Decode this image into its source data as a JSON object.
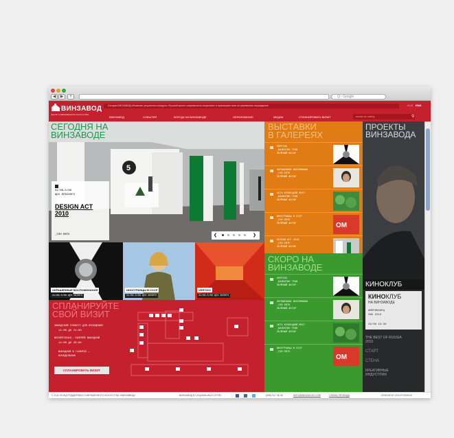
{
  "browser": {
    "search_placeholder": "Q~ Google"
  },
  "header": {
    "logo": "ВИНЗАВОД",
    "logo_sub": "ЦЕНТР СОВРЕМЕННОГО ИСКУССТВА",
    "news_ticker": "Сегодня ВИНЗАВОД объявляет результаты конкурса «Лучший проект современного искусства» и приглашает всех на церемонию награждения",
    "lang_ru": "RUS",
    "lang_en": "ENG",
    "menu": [
      "ВИНЗАВОД",
      "СОБЫТИЯ",
      "ВСЕГДА НА ВИНЗАВОДЕ",
      "ОБРАЗОВАНИЕ",
      "МЕДИА",
      "СПЛАНИРОВАТЬ ВИЗИТ"
    ],
    "search_placeholder": "поиск по сайту"
  },
  "hero": {
    "title_line1": "СЕГОДНЯ НА",
    "title_line2": "ВИНЗАВОДЕ",
    "card_date": "31/08–5/09",
    "card_venue": "ЦЕХ КРАСНОГО",
    "card_title": "DESIGN ACT 2010",
    "card_link": "_УЗН ЕВТЕ"
  },
  "thumbs": [
    {
      "caption": "ОКРАШЕННЫЕ ВОСПОМИНАНИЯ",
      "date": "31/08–5/09  ЦЕХ БЕЛОГО"
    },
    {
      "caption": "ИНОСТРАНЦЫ В СССР",
      "date": "31/08–5/09  ЦЕХ БЕЛОГО"
    },
    {
      "caption": "VERTIGO",
      "date": "31/08–5/09  ЦЕХ БЕЛОГО"
    }
  ],
  "plan": {
    "title_line1": "СПЛАНИРУЙТЕ",
    "title_line2": "СВОЙ ВИЗИТ",
    "hours1_label": "ЗАВОДСКОЙ СУББОТУ ДЛЯ ПОСЕЩЕНИЯ",
    "hours1": "11:00 ДО 21:00",
    "hours2_label": "ВОСКРЕСЕНЬЕ, ГАЛЕРЕЙ ВЫХОДНОЙ",
    "hours2": "12:00 ДО 20:00",
    "closed": "ВЫХОДНОЙ В ГАЛЕРЕЕ — ПОНЕДЕЛЬНИК",
    "button": "СПЛАНИРОВАТЬ ВИЗИТ"
  },
  "galleries": {
    "title_line1": "ВЫСТАВКИ",
    "title_line2": "В ГАЛЕРЕЯХ",
    "items": [
      {
        "text": "VERTIGO\n_ВАЛЕНТИН ТРАВ\nЗЕЛЁНЫЙ АНГАР"
      },
      {
        "text": "ОКРАШЕННЫЕ ВОСПОМИНАН\n_УЗН ЕВТЕ\nЗЕЛЁНЫЙ АНГАР"
      },
      {
        "text": "1974 КУЗНЕЦКИЙ МОСТ\n_ВАЛЕНТИН ТРАВ\nЗЕЛЁНЫЙ АНГАР"
      },
      {
        "text": "ИНОСТРАНЦЫ В СССР\n_УЗН ЕВТЕ\nЗЕЛЁНЫЙ АНГАР"
      },
      {
        "text": "DESIGN ACT 2010\n_УЗН ЕВТЕ\nЗЕЛЁНЫЙ АНГАР"
      }
    ]
  },
  "soon": {
    "title_line1": "СКОРО НА",
    "title_line2": "ВИНЗАВОДЕ",
    "items": [
      {
        "text": "VERTIGO\n_ВАЛЕНТИН ТРАВ\nЗЕЛЁНЫЙ АНГАР"
      },
      {
        "text": "ОКРАШЕННЫЕ ВОСПОМИНАН\n_УЗН ЕВТЕ\nЗЕЛЁНЫЙ АНГАР"
      },
      {
        "text": "1974 КУЗНЕЦКИЙ МОСТ\n_ВАЛЕНТИН ТРАВ\nЗЕЛЁНЫЙ АНГАР"
      },
      {
        "text": "ИНОСТРАНЦЫ В СССР\n_УЗН ЕВТЕ"
      }
    ]
  },
  "projects": {
    "title_line1": "ПРОЕКТЫ",
    "title_line2": "ВИНЗАВОДА",
    "kinoclub": "КИНОКЛУБ",
    "kino_bold": "КИНО",
    "kino_rest": "КЛУБ",
    "kino_sub": "НА ВИНЗАВОДЕ",
    "film": "АМЕРИКАНЕЦ",
    "film_year": "США 2010",
    "showtime": "29/08 19:30",
    "links": [
      "THE BEST OF RUSSIA 2010",
      "СТАРТ",
      "СТЕНА",
      "КРЕАТИВНЫЕ ИНДУСТРИИ"
    ]
  },
  "footer": {
    "copyright": "© 2010 ФОНД ПОДДЕРЖКИ СОВРЕМЕННОГО ИСКУССТВА «ВИНЗАВОД»",
    "social": "ВИНЗАВОД В СОЦИАЛЬНЫХ СЕТЯХ",
    "phone": "(495) 917 46 46",
    "email": "INFO@WINZAVOD.COM",
    "directions": "СХЕМА ПРОЕЗДА",
    "credit": "DESIGN BY ZOLOTONIKOV"
  },
  "colors": {
    "red": "#c5202e",
    "orange": "#e07c13",
    "green": "#3b9a2e",
    "dark": "#3a3c3f"
  }
}
